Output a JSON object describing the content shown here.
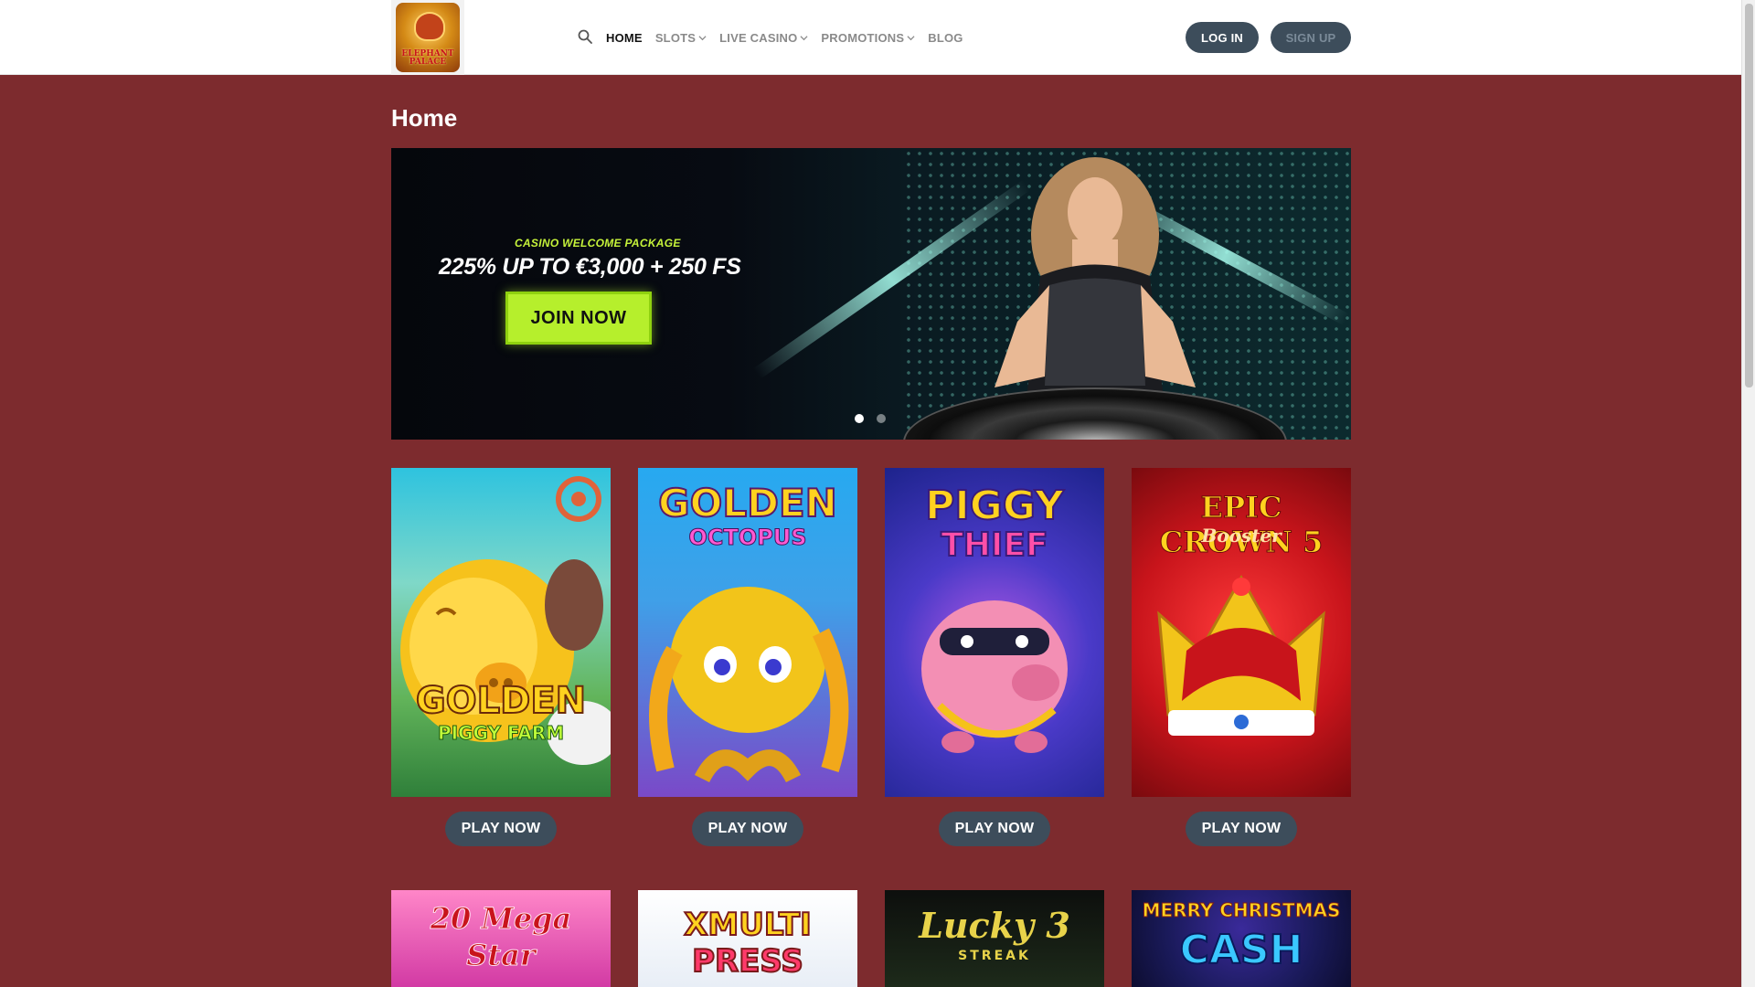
{
  "header": {
    "logo_text": "ELEPHANT PALACE",
    "nav": [
      {
        "label": "HOME",
        "active": true,
        "dropdown": false
      },
      {
        "label": "SLOTS",
        "active": false,
        "dropdown": true
      },
      {
        "label": "LIVE CASINO",
        "active": false,
        "dropdown": true
      },
      {
        "label": "PROMOTIONS",
        "active": false,
        "dropdown": true
      },
      {
        "label": "BLOG",
        "active": false,
        "dropdown": false
      }
    ],
    "login_label": "LOG IN",
    "signup_label": "SIGN UP"
  },
  "page": {
    "title": "Home"
  },
  "banner": {
    "eyebrow": "CASINO WELCOME PACKAGE",
    "headline": "225% UP TO €3,000 + 250 FS",
    "cta": "JOIN NOW",
    "slide_count": 2,
    "active_slide": 1
  },
  "games": [
    {
      "title_line1": "GOLDEN",
      "title_line2": "PIGGY FARM",
      "play_label": "PLAY NOW"
    },
    {
      "title_line1": "GOLDEN",
      "title_line2": "OCTOPUS",
      "play_label": "PLAY NOW"
    },
    {
      "title_line1": "PIGGY",
      "title_line2": "THIEF",
      "play_label": "PLAY NOW"
    },
    {
      "title_line1": "EPIC CROWN 5",
      "title_line2": "Booster",
      "play_label": "PLAY NOW"
    }
  ],
  "games_row2": [
    {
      "title_line1": "20 Mega",
      "title_line2": "Star"
    },
    {
      "title_line1": "XMULTI",
      "title_line2": "PRESS"
    },
    {
      "title_line1": "Lucky 3",
      "title_line2": "STREAK"
    },
    {
      "title_line1": "MERRY CHRISTMAS",
      "title_line2": "CASH"
    }
  ],
  "colors": {
    "page_bg": "#7d2b2e",
    "button_bg": "#3d4d5b",
    "cta_green": "#b6ef2c"
  }
}
